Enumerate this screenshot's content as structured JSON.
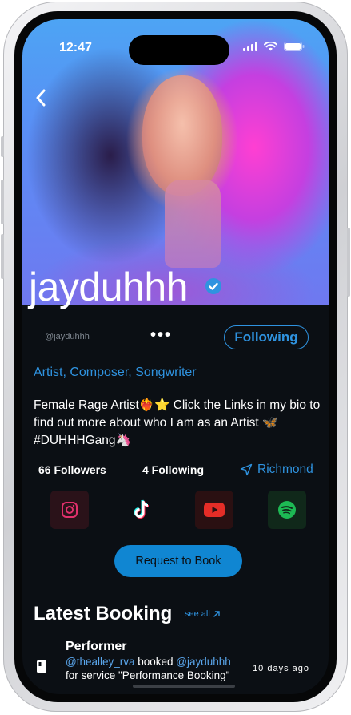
{
  "status_bar": {
    "time": "12:47"
  },
  "profile": {
    "name": "jayduhhh",
    "handle": "@jayduhhh",
    "follow_button": "Following",
    "more_label": "•••",
    "roles": "Artist, Composer, Songwriter",
    "bio": "Female Rage Artist❤️‍🔥⭐️   Click the Links in my bio to find out more about who I am as an Artist 🦋  #DUHHHGang🦄",
    "stats": {
      "followers": "66 Followers",
      "following": "4 Following",
      "location": "Richmond"
    },
    "socials": [
      {
        "name": "instagram-icon",
        "color": "#e1306c"
      },
      {
        "name": "tiktok-icon",
        "color": "#ffffff"
      },
      {
        "name": "youtube-icon",
        "color": "#e52d27"
      },
      {
        "name": "spotify-icon",
        "color": "#1db954"
      }
    ],
    "request_button": "Request to Book"
  },
  "latest_booking": {
    "title": "Latest Booking",
    "see_all": "see all",
    "item": {
      "role": "Performer",
      "from": "@thealley_rva",
      "verb": " booked ",
      "to": "@jayduhhh",
      "service": "for service \"Performance Booking\"",
      "time": "10 days ago"
    }
  },
  "colors": {
    "accent": "#2f93e0",
    "button": "#1086d2",
    "background": "#0b0f14"
  }
}
